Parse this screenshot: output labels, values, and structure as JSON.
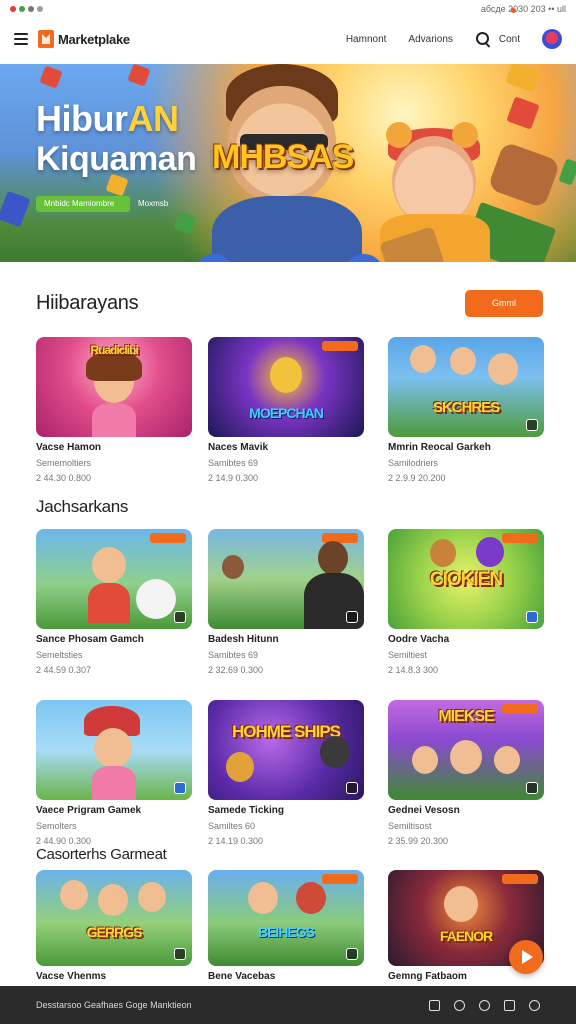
{
  "status_bar": {
    "right": "абсде 2030 203 •• ull"
  },
  "header": {
    "logo": "Marketplake",
    "nav": [
      "Hamnont",
      "Advarions",
      "Cont"
    ]
  },
  "hero": {
    "title_line1_a": "Hibur",
    "title_line1_b": "AN",
    "title_line2": "Kiquaman",
    "game_logo": "MHBSAS",
    "primary_button": "Mnbidc Mamiombre",
    "secondary_link": "Moxmsb"
  },
  "sections": [
    {
      "title": "Hiibarayans",
      "button": "Gmml",
      "cards": [
        {
          "thumb_text": "Ruadiclibi",
          "name": "Vacse Hamon",
          "sub": "Sememoltiers",
          "meta": "2 44.30 0.800"
        },
        {
          "thumb_text": "MOEPCHAN",
          "name": "Naces Mavik",
          "sub": "Samibtes 69",
          "meta": "2 14.9 0.300"
        },
        {
          "thumb_text": "SKCHRES",
          "name": "Mmrin Reocal Garkeh",
          "sub": "Samilodriers",
          "meta": "2 2.9.9 20.200"
        }
      ]
    },
    {
      "title": "Jachsarkans",
      "button": "",
      "cards": [
        {
          "thumb_text": "",
          "name": "Sance Phosam Gamch",
          "sub": "Semeltsties",
          "meta": "2 44.59 0.307"
        },
        {
          "thumb_text": "",
          "name": "Badesh Hitunn",
          "sub": "Samibtes 69",
          "meta": "2 32.69 0.300"
        },
        {
          "thumb_text": "CIOKIEN",
          "name": "Oodre Vacha",
          "sub": "Semiltiest",
          "meta": "2 14.8.3 300"
        },
        {
          "thumb_text": "",
          "name": "Vaece Prigram Gamek",
          "sub": "Semolters",
          "meta": "2 44.90 0.300"
        },
        {
          "thumb_text": "HOHME SHIPS",
          "name": "Samede Ticking",
          "sub": "Samiltes 60",
          "meta": "2 14.19 0.300"
        },
        {
          "thumb_text": "MIEKSE",
          "name": "Gednei Vesosn",
          "sub": "Semiltisost",
          "meta": "2 35.99 20.300"
        }
      ]
    },
    {
      "title": "Casorterhs Garmeat",
      "button": "",
      "cards": [
        {
          "thumb_text": "GERRGS",
          "name": "Vacse Vhenms",
          "sub": "",
          "meta": ""
        },
        {
          "thumb_text": "BEIHEGS",
          "name": "Bene Vacebas",
          "sub": "",
          "meta": ""
        },
        {
          "thumb_text": "FAENOR",
          "name": "Gemng Fatbaom",
          "sub": "",
          "meta": ""
        }
      ]
    }
  ],
  "footer": {
    "text": "Desstarsoo Geafhaes Goge Manktieon"
  },
  "colors": {
    "accent": "#f26b1d",
    "hero_button": "#67c23a",
    "footer_bg": "#2b2b2b"
  }
}
